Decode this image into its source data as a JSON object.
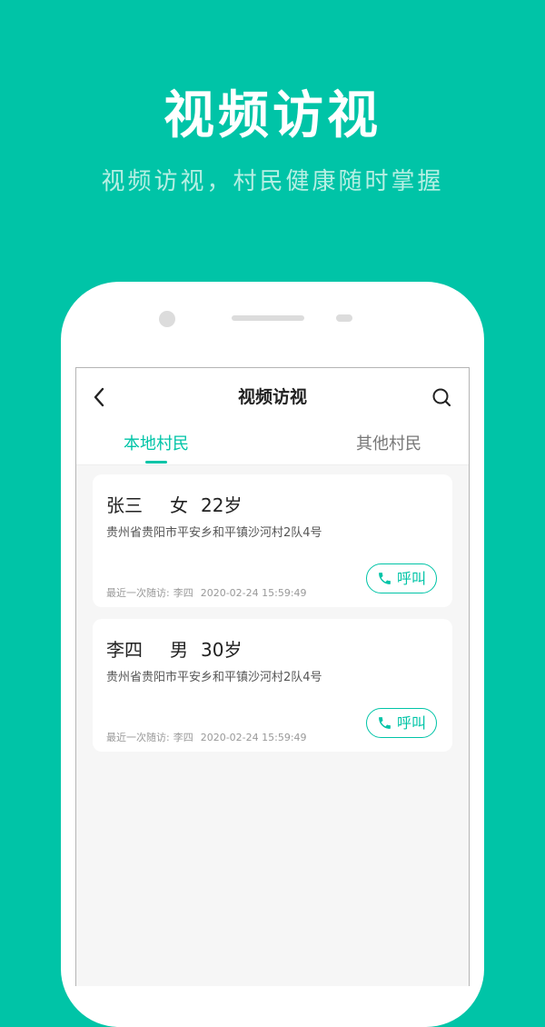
{
  "hero": {
    "title": "视频访视",
    "subtitle": "视频访视，村民健康随时掌握"
  },
  "app": {
    "nav_title": "视频访视",
    "tabs": [
      {
        "label": "本地村民",
        "active": true
      },
      {
        "label": "其他村民",
        "active": false
      }
    ],
    "residents": [
      {
        "name": "张三",
        "gender": "女",
        "age": "22岁",
        "address": "贵州省贵阳市平安乡和平镇沙河村2队4号",
        "last_visit_label": "最近一次随访:",
        "last_visit_person": "李四",
        "last_visit_time": "2020-02-24 15:59:49",
        "call_label": "呼叫"
      },
      {
        "name": "李四",
        "gender": "男",
        "age": "30岁",
        "address": "贵州省贵阳市平安乡和平镇沙河村2队4号",
        "last_visit_label": "最近一次随访:",
        "last_visit_person": "李四",
        "last_visit_time": "2020-02-24 15:59:49",
        "call_label": "呼叫"
      }
    ]
  },
  "icons": {
    "back": "chevron-left-icon",
    "search": "search-icon",
    "call": "phone-icon"
  },
  "colors": {
    "brand": "#00c4a7",
    "background": "#00c4a7",
    "subtitle": "#b6efe3"
  }
}
